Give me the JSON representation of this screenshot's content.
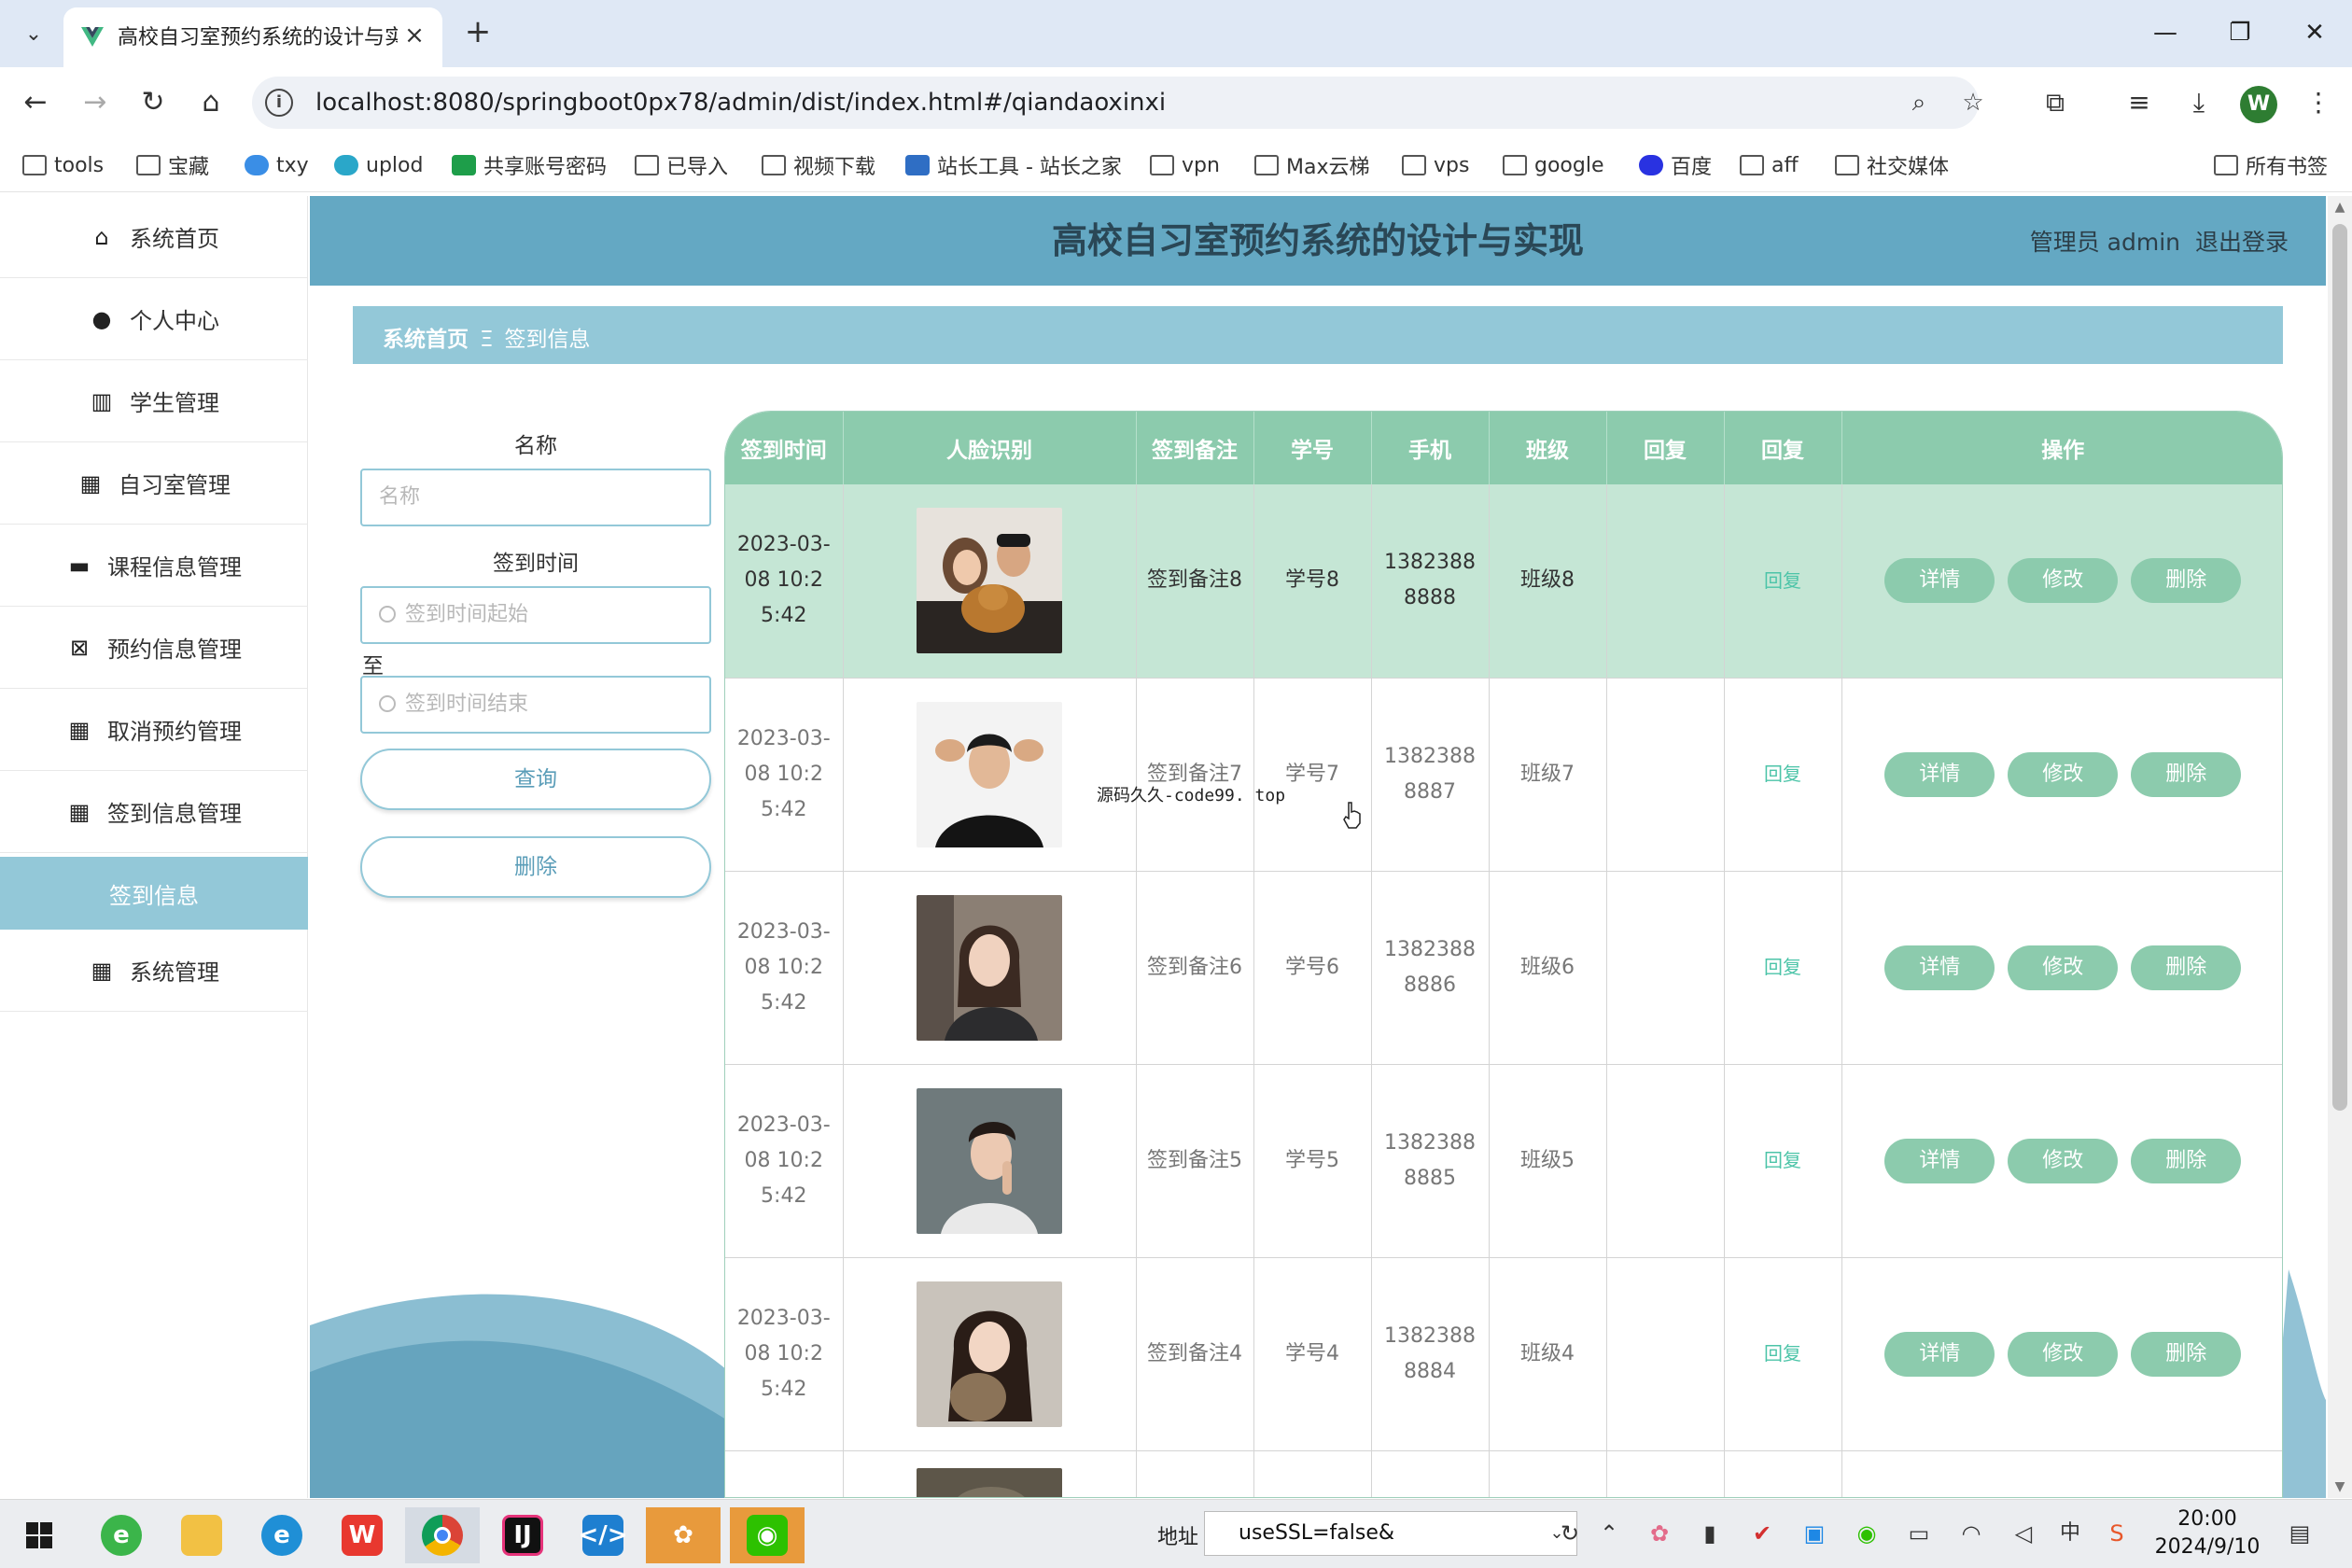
{
  "browser": {
    "tab_title": "高校自习室预约系统的设计与实",
    "url": "localhost:8080/springboot0px78/admin/dist/index.html#/qiandaoxinxi",
    "bookmarks": [
      "tools",
      "宝藏",
      "txy",
      "uplod",
      "共享账号密码",
      "已导入",
      "视频下载",
      "站长工具 - 站长之家",
      "vpn",
      "Max云梯",
      "vps",
      "google",
      "百度",
      "aff",
      "社交媒体"
    ],
    "all_bookmarks": "所有书签",
    "profile_initial": "W"
  },
  "sidebar": {
    "items": [
      {
        "label": "系统首页",
        "icon": "home-icon"
      },
      {
        "label": "个人中心",
        "icon": "user-icon"
      },
      {
        "label": "学生管理",
        "icon": "book-icon"
      },
      {
        "label": "自习室管理",
        "icon": "grid-icon"
      },
      {
        "label": "课程信息管理",
        "icon": "ticket-icon"
      },
      {
        "label": "预约信息管理",
        "icon": "calendar-x-icon"
      },
      {
        "label": "取消预约管理",
        "icon": "grid-dots-icon"
      },
      {
        "label": "签到信息管理",
        "icon": "grid-icon"
      },
      {
        "label": "签到信息",
        "icon": ""
      },
      {
        "label": "系统管理",
        "icon": "grid-icon"
      }
    ]
  },
  "header": {
    "title": "高校自习室预约系统的设计与实现",
    "user": "管理员 admin",
    "logout": "退出登录"
  },
  "breadcrumb": {
    "home": "系统首页",
    "separator": "Ξ",
    "current": "签到信息"
  },
  "search": {
    "name_label": "名称",
    "name_placeholder": "名称",
    "time_label": "签到时间",
    "time_start_placeholder": "签到时间起始",
    "to_label": "至",
    "time_end_placeholder": "签到时间结束",
    "query_button": "查询",
    "delete_button": "删除"
  },
  "table": {
    "columns": [
      "签到时间",
      "人脸识别",
      "签到备注",
      "学号",
      "手机",
      "班级",
      "回复",
      "回复",
      "操作"
    ],
    "actions": {
      "detail": "详情",
      "edit": "修改",
      "delete": "删除",
      "reply": "回复"
    },
    "rows": [
      {
        "time": "2023-03-08 10:25:42",
        "remark": "签到备注8",
        "student_no": "学号8",
        "phone": "13823888888",
        "class": "班级8",
        "reply": ""
      },
      {
        "time": "2023-03-08 10:25:42",
        "remark": "签到备注7",
        "student_no": "学号7",
        "phone": "13823888887",
        "class": "班级7",
        "reply": ""
      },
      {
        "time": "2023-03-08 10:25:42",
        "remark": "签到备注6",
        "student_no": "学号6",
        "phone": "13823888886",
        "class": "班级6",
        "reply": ""
      },
      {
        "time": "2023-03-08 10:25:42",
        "remark": "签到备注5",
        "student_no": "学号5",
        "phone": "13823888885",
        "class": "班级5",
        "reply": ""
      },
      {
        "time": "2023-03-08 10:25:42",
        "remark": "签到备注4",
        "student_no": "学号4",
        "phone": "13823888884",
        "class": "班级4",
        "reply": ""
      }
    ]
  },
  "overlay_text": "源码久久-code99. top",
  "taskbar": {
    "address_label": "地址",
    "address_value": "useSSL=false&",
    "time": "20:00",
    "date": "2024/9/10",
    "ime": "中"
  },
  "colors": {
    "header": "#64a8c3",
    "accent": "#93c8d8",
    "table_header": "#8ccbad",
    "row_highlight": "#c5e6d5"
  }
}
